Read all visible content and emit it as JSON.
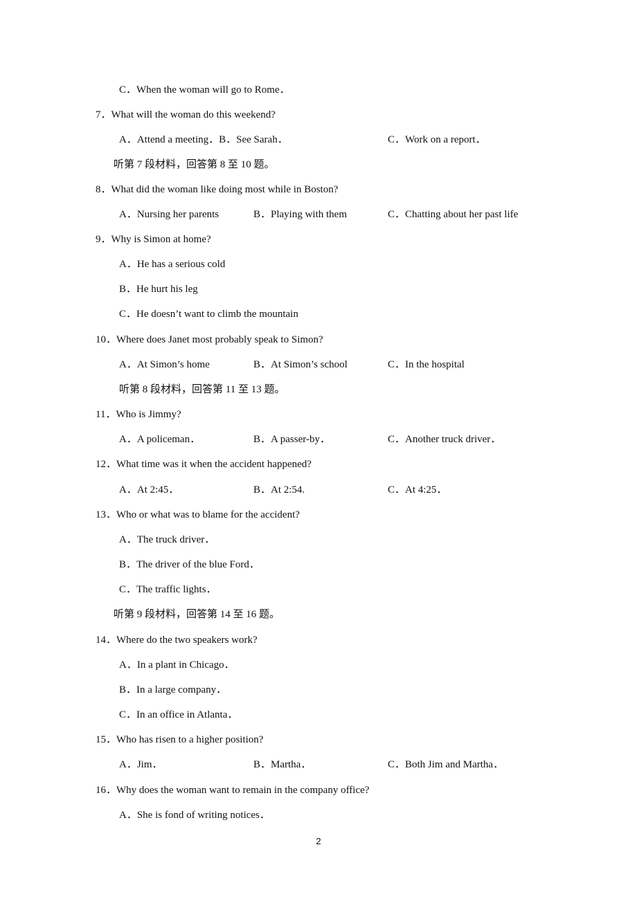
{
  "page": {
    "page_number": "2",
    "lines": {
      "q6c": "C．When the woman will go to Rome．",
      "q7": "7．What will the woman do this weekend?",
      "q7a": "A．Attend a meeting．B．See Sarah．",
      "q7c": "C．Work on a report．",
      "note7": "听第 7 段材料，回答第 8 至 10 题。",
      "q8": "8．What did the woman like doing most while in Boston?",
      "q8a": "A．Nursing her parents",
      "q8b": "B．Playing with them",
      "q8c": "C．Chatting about her past life",
      "q9": "9．Why is Simon at home?",
      "q9a": "A．He has a serious cold",
      "q9b": "B．He hurt his leg",
      "q9c": "C．He doesn’t want to climb the mountain",
      "q10": "10．Where does Janet most probably speak to Simon?",
      "q10a": "A．At Simon’s home",
      "q10b": "B．At Simon’s school",
      "q10c": "C．In the hospital",
      "note8": "听第 8 段材料，回答第 11 至 13 题。",
      "q11": "11．Who is Jimmy?",
      "q11a": "A．A policeman．",
      "q11b": "B．A passer-by．",
      "q11c": "C．Another truck driver．",
      "q12": "12．What time was it when the accident happened?",
      "q12a": "A．At 2:45．",
      "q12b": "B．At 2:54.",
      "q12c": "C．At 4:25．",
      "q13": "13．Who or what was to blame for the accident?",
      "q13a": "A．The truck driver．",
      "q13b": "B．The driver of the blue Ford．",
      "q13c": "C．The traffic lights．",
      "note9": "听第 9 段材料，回答第 14 至 16 题。",
      "q14": "14．Where do the two speakers work?",
      "q14a": "A．In a plant in Chicago．",
      "q14b": "B．In a large company．",
      "q14c": "C．In an office in Atlanta．",
      "q15": "15．Who has risen to a higher position?",
      "q15a": "A．Jim．",
      "q15b": "B．Martha．",
      "q15c": "C．Both Jim and Martha．",
      "q16": "16．Why does the woman want to remain in the company office?",
      "q16a": "A．She is fond of writing notices．"
    }
  }
}
